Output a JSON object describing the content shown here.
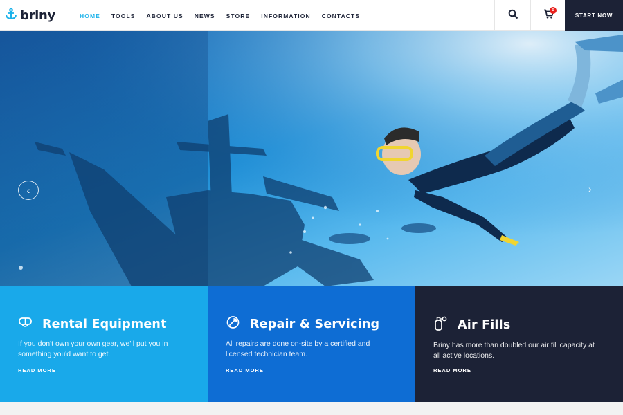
{
  "header": {
    "logo_text": "briny",
    "nav": [
      "HOME",
      "TOOLS",
      "ABOUT US",
      "NEWS",
      "STORE",
      "INFORMATION",
      "CONTACTS"
    ],
    "active_nav": "HOME",
    "cart_count": "0",
    "start_label": "START NOW",
    "accent": "#1bb2ea",
    "dark": "#1c2236"
  },
  "hero": {
    "left_arrow_icon": "chevron-left-icon",
    "right_arrow_icon": "chevron-right-icon"
  },
  "cards": [
    {
      "icon": "mask-icon",
      "title": "Rental Equipment",
      "text": "If you don't own your own gear, we'll put you in something you'd want to get.",
      "link": "READ MORE",
      "color": "#19a9ea"
    },
    {
      "icon": "wrench-icon",
      "title": "Repair & Servicing",
      "text": "All repairs are done on-site by a certified and licensed technician team.",
      "link": "READ MORE",
      "color": "#0e6dd4"
    },
    {
      "icon": "air-tank-icon",
      "title": "Air Fills",
      "text": "Briny has more than doubled our air fill capacity at all active locations.",
      "link": "READ MORE",
      "color": "#1c2236"
    }
  ]
}
